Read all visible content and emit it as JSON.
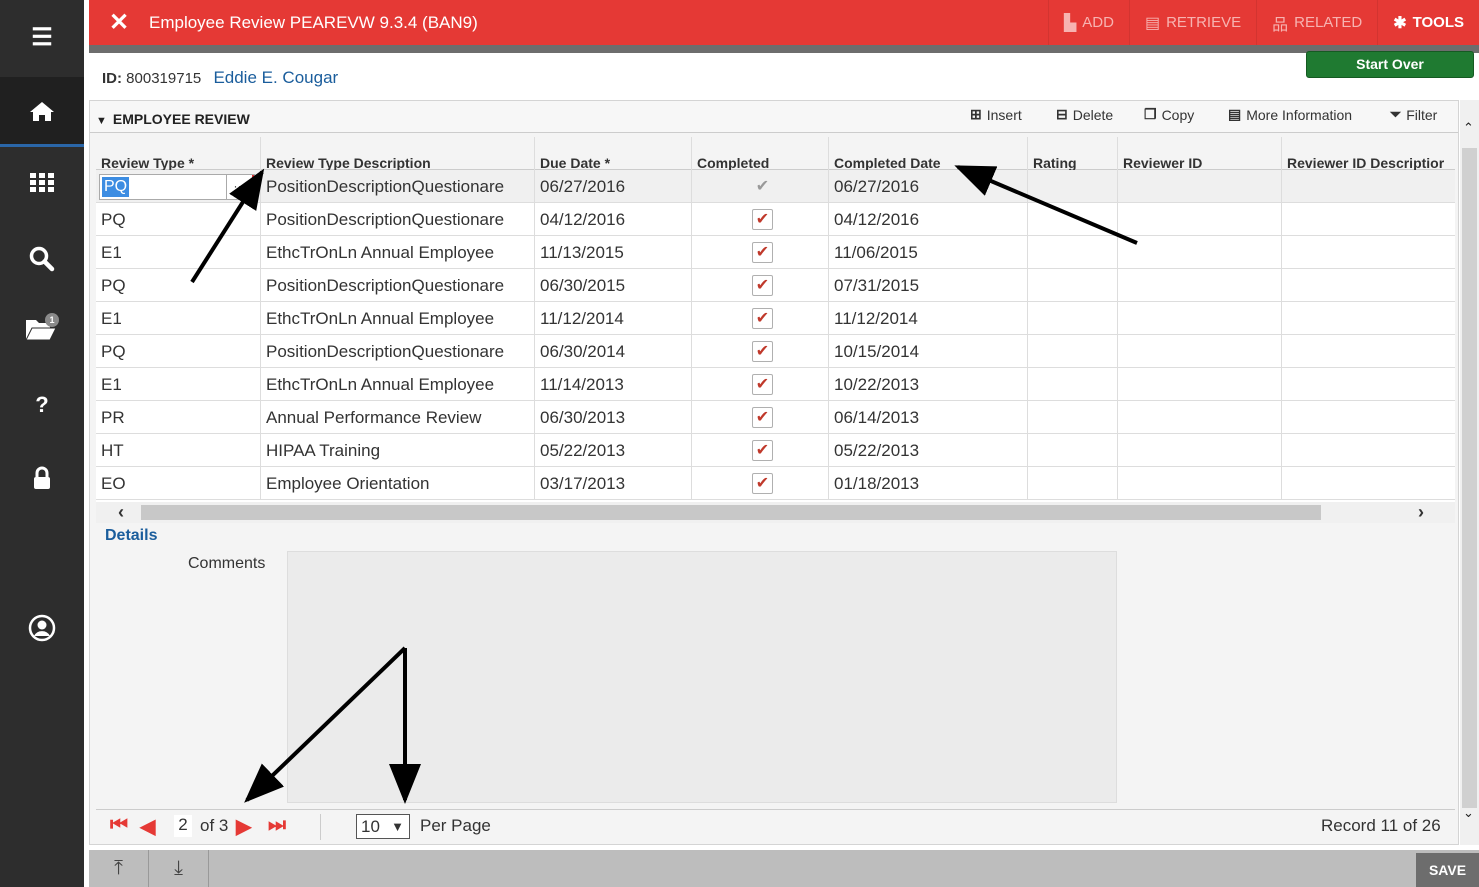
{
  "topbar": {
    "title": "Employee Review PEAREVW 9.3.4 (BAN9)",
    "close_glyph": "✕",
    "actions": {
      "add": "ADD",
      "retrieve": "RETRIEVE",
      "related": "RELATED",
      "tools": "TOOLS"
    }
  },
  "start_over": "Start Over",
  "key": {
    "id_label": "ID:",
    "id_value": "800319715",
    "name": "Eddie E. Cougar"
  },
  "block": {
    "title": "EMPLOYEE REVIEW",
    "toolbar": {
      "insert": "Insert",
      "delete": "Delete",
      "copy": "Copy",
      "more": "More Information",
      "filter": "Filter"
    }
  },
  "grid": {
    "headers": [
      "Review Type *",
      "Review Type Description",
      "Due Date *",
      "Completed",
      "Completed Date",
      "Rating",
      "Reviewer ID",
      "Reviewer ID Descriptior"
    ],
    "rows": [
      {
        "type": "PQ",
        "desc": "PositionDescriptionQuestionare",
        "due": "06/27/2016",
        "completed": true,
        "completed_date": "06/27/2016"
      },
      {
        "type": "PQ",
        "desc": "PositionDescriptionQuestionare",
        "due": "04/12/2016",
        "completed": true,
        "completed_date": "04/12/2016"
      },
      {
        "type": "E1",
        "desc": "EthcTrOnLn Annual Employee",
        "due": "11/13/2015",
        "completed": true,
        "completed_date": "11/06/2015"
      },
      {
        "type": "PQ",
        "desc": "PositionDescriptionQuestionare",
        "due": "06/30/2015",
        "completed": true,
        "completed_date": "07/31/2015"
      },
      {
        "type": "E1",
        "desc": "EthcTrOnLn Annual Employee",
        "due": "11/12/2014",
        "completed": true,
        "completed_date": "11/12/2014"
      },
      {
        "type": "PQ",
        "desc": "PositionDescriptionQuestionare",
        "due": "06/30/2014",
        "completed": true,
        "completed_date": "10/15/2014"
      },
      {
        "type": "E1",
        "desc": "EthcTrOnLn Annual Employee",
        "due": "11/14/2013",
        "completed": true,
        "completed_date": "10/22/2013"
      },
      {
        "type": "PR",
        "desc": "Annual Performance Review",
        "due": "06/30/2013",
        "completed": true,
        "completed_date": "06/14/2013"
      },
      {
        "type": "HT",
        "desc": "HIPAA Training",
        "due": "05/22/2013",
        "completed": true,
        "completed_date": "05/22/2013"
      },
      {
        "type": "EO",
        "desc": "Employee Orientation",
        "due": "03/17/2013",
        "completed": true,
        "completed_date": "01/18/2013"
      }
    ]
  },
  "details": {
    "title": "Details",
    "comments_label": "Comments"
  },
  "pager": {
    "page": "2",
    "of": "of 3",
    "per_page_value": "10",
    "per_page_label": "Per Page",
    "record": "Record 11 of 26"
  },
  "save": "SAVE",
  "notifications": {
    "folder_badge": "1"
  },
  "colors": {
    "topbar": "#e53935",
    "sidebar": "#2d2d2d",
    "start_over": "#1f7a31",
    "link": "#1a5d9c"
  }
}
